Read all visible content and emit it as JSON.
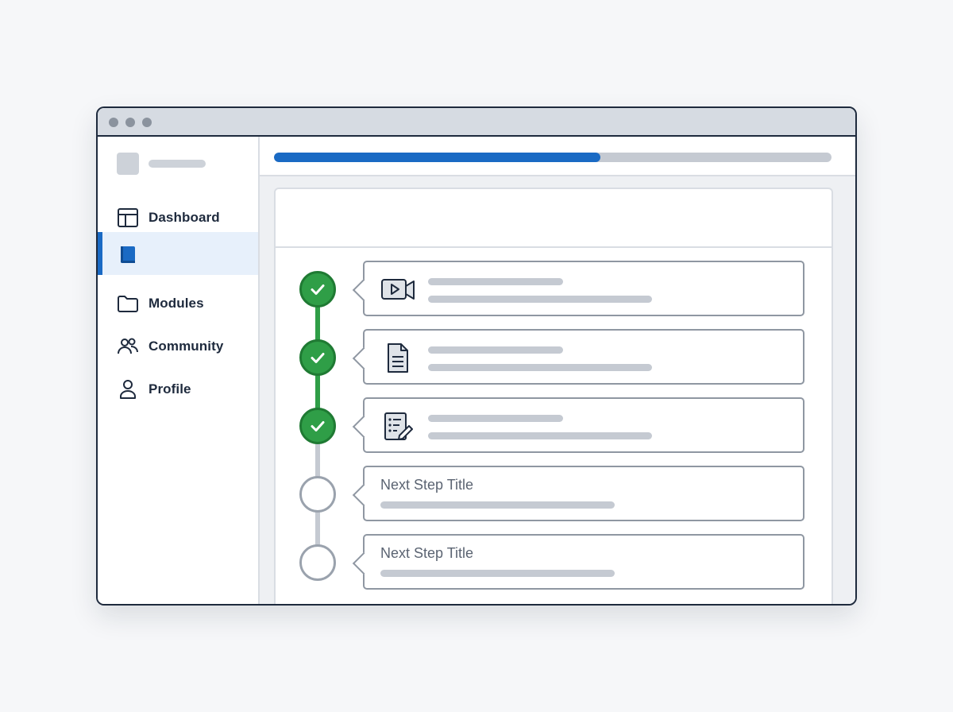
{
  "sidebar": {
    "items": [
      {
        "label": "Dashboard",
        "icon": "layout-icon",
        "active": false
      },
      {
        "label": "",
        "icon": "book-icon",
        "active": true
      },
      {
        "label": "Modules",
        "icon": "folder-icon",
        "active": false
      },
      {
        "label": "Community",
        "icon": "users-icon",
        "active": false
      },
      {
        "label": "Profile",
        "icon": "user-icon",
        "active": false
      }
    ]
  },
  "progress": {
    "fraction": 0.585,
    "fill_color": "#1a6ac4",
    "track_color": "#c5cad2"
  },
  "steps": [
    {
      "status": "completed",
      "icon": "video-camera-icon"
    },
    {
      "status": "completed",
      "icon": "document-icon"
    },
    {
      "status": "completed",
      "icon": "checklist-edit-icon"
    },
    {
      "status": "pending",
      "title": "Next Step Title"
    },
    {
      "status": "pending",
      "title": "Next Step Title"
    }
  ],
  "colors": {
    "accent": "#1a6ac4",
    "complete": "#2f9e47",
    "complete_border": "#1f7a33",
    "pending_border": "#9aa2ad",
    "frame": "#1e2a3d"
  }
}
